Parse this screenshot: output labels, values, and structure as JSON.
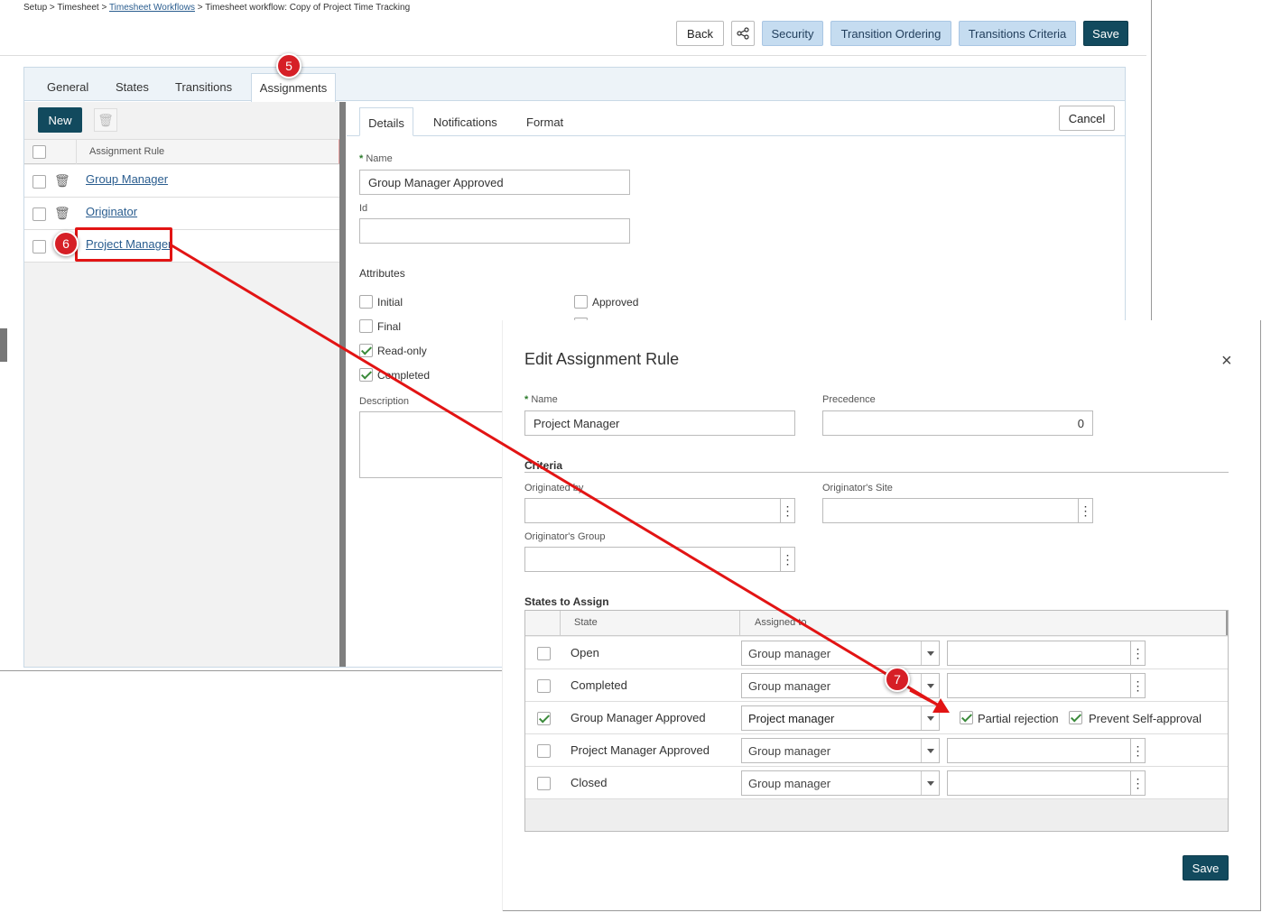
{
  "breadcrumb": {
    "setup": "Setup",
    "sep": ">",
    "timesheet": "Timesheet",
    "workflows": "Timesheet Workflows",
    "current": "Timesheet workflow: Copy of Project Time Tracking"
  },
  "toolbar": {
    "back": "Back",
    "security": "Security",
    "transition_ordering": "Transition Ordering",
    "transitions_criteria": "Transitions Criteria",
    "save": "Save"
  },
  "tabs": [
    "General",
    "States",
    "Transitions",
    "Assignments"
  ],
  "left": {
    "new": "New",
    "column": "Assignment Rule",
    "rules": [
      "Group Manager",
      "Originator",
      "Project Manager"
    ]
  },
  "subtabs": [
    "Details",
    "Notifications",
    "Format"
  ],
  "details": {
    "cancel": "Cancel",
    "name_label": "Name",
    "name_value": "Group Manager Approved",
    "id_label": "Id",
    "attributes_label": "Attributes",
    "attr_initial": "Initial",
    "attr_final": "Final",
    "attr_readonly": "Read-only",
    "attr_completed": "Completed",
    "attr_approved": "Approved",
    "description_label": "Description"
  },
  "dialog": {
    "title": "Edit Assignment Rule",
    "close": "×",
    "name_label": "Name",
    "name_value": "Project Manager",
    "precedence_label": "Precedence",
    "precedence_value": "0",
    "criteria": "Criteria",
    "originated_by": "Originated by",
    "originators_site": "Originator's Site",
    "originators_group": "Originator's Group",
    "states_to_assign": "States to Assign",
    "col_state": "State",
    "col_assigned": "Assigned to",
    "rows": [
      {
        "state": "Open",
        "assigned": "Group manager"
      },
      {
        "state": "Completed",
        "assigned": "Group manager"
      },
      {
        "state": "Group Manager Approved",
        "assigned": "Project manager",
        "partial": "Partial rejection",
        "prevent": "Prevent Self-approval"
      },
      {
        "state": "Project Manager Approved",
        "assigned": "Group manager"
      },
      {
        "state": "Closed",
        "assigned": "Group manager"
      }
    ],
    "save": "Save"
  },
  "markers": {
    "m5": "5",
    "m6": "6",
    "m7": "7"
  },
  "colors": {
    "primary_dark": "#124a5e",
    "accent_light": "#c5dcf0",
    "marker_red": "#d61f26",
    "link": "#2a5d8f"
  }
}
